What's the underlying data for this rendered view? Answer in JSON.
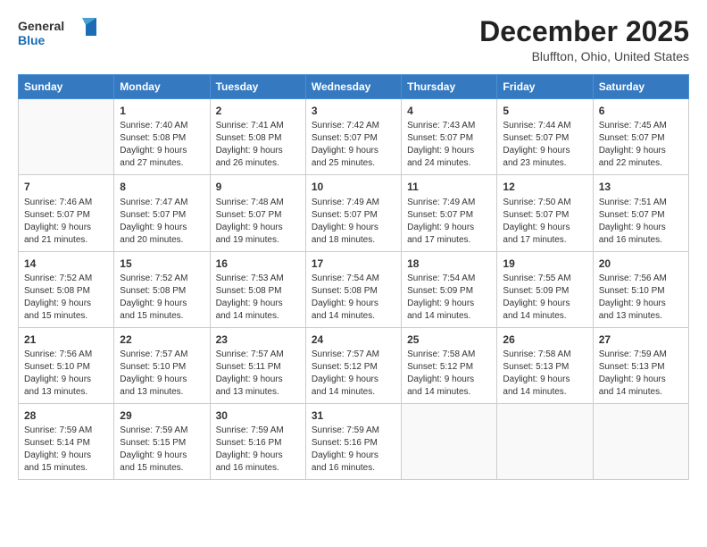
{
  "header": {
    "logo_line1": "General",
    "logo_line2": "Blue",
    "month": "December 2025",
    "location": "Bluffton, Ohio, United States"
  },
  "weekdays": [
    "Sunday",
    "Monday",
    "Tuesday",
    "Wednesday",
    "Thursday",
    "Friday",
    "Saturday"
  ],
  "weeks": [
    [
      {
        "day": "",
        "info": ""
      },
      {
        "day": "1",
        "info": "Sunrise: 7:40 AM\nSunset: 5:08 PM\nDaylight: 9 hours\nand 27 minutes."
      },
      {
        "day": "2",
        "info": "Sunrise: 7:41 AM\nSunset: 5:08 PM\nDaylight: 9 hours\nand 26 minutes."
      },
      {
        "day": "3",
        "info": "Sunrise: 7:42 AM\nSunset: 5:07 PM\nDaylight: 9 hours\nand 25 minutes."
      },
      {
        "day": "4",
        "info": "Sunrise: 7:43 AM\nSunset: 5:07 PM\nDaylight: 9 hours\nand 24 minutes."
      },
      {
        "day": "5",
        "info": "Sunrise: 7:44 AM\nSunset: 5:07 PM\nDaylight: 9 hours\nand 23 minutes."
      },
      {
        "day": "6",
        "info": "Sunrise: 7:45 AM\nSunset: 5:07 PM\nDaylight: 9 hours\nand 22 minutes."
      }
    ],
    [
      {
        "day": "7",
        "info": "Sunrise: 7:46 AM\nSunset: 5:07 PM\nDaylight: 9 hours\nand 21 minutes."
      },
      {
        "day": "8",
        "info": "Sunrise: 7:47 AM\nSunset: 5:07 PM\nDaylight: 9 hours\nand 20 minutes."
      },
      {
        "day": "9",
        "info": "Sunrise: 7:48 AM\nSunset: 5:07 PM\nDaylight: 9 hours\nand 19 minutes."
      },
      {
        "day": "10",
        "info": "Sunrise: 7:49 AM\nSunset: 5:07 PM\nDaylight: 9 hours\nand 18 minutes."
      },
      {
        "day": "11",
        "info": "Sunrise: 7:49 AM\nSunset: 5:07 PM\nDaylight: 9 hours\nand 17 minutes."
      },
      {
        "day": "12",
        "info": "Sunrise: 7:50 AM\nSunset: 5:07 PM\nDaylight: 9 hours\nand 17 minutes."
      },
      {
        "day": "13",
        "info": "Sunrise: 7:51 AM\nSunset: 5:07 PM\nDaylight: 9 hours\nand 16 minutes."
      }
    ],
    [
      {
        "day": "14",
        "info": "Sunrise: 7:52 AM\nSunset: 5:08 PM\nDaylight: 9 hours\nand 15 minutes."
      },
      {
        "day": "15",
        "info": "Sunrise: 7:52 AM\nSunset: 5:08 PM\nDaylight: 9 hours\nand 15 minutes."
      },
      {
        "day": "16",
        "info": "Sunrise: 7:53 AM\nSunset: 5:08 PM\nDaylight: 9 hours\nand 14 minutes."
      },
      {
        "day": "17",
        "info": "Sunrise: 7:54 AM\nSunset: 5:08 PM\nDaylight: 9 hours\nand 14 minutes."
      },
      {
        "day": "18",
        "info": "Sunrise: 7:54 AM\nSunset: 5:09 PM\nDaylight: 9 hours\nand 14 minutes."
      },
      {
        "day": "19",
        "info": "Sunrise: 7:55 AM\nSunset: 5:09 PM\nDaylight: 9 hours\nand 14 minutes."
      },
      {
        "day": "20",
        "info": "Sunrise: 7:56 AM\nSunset: 5:10 PM\nDaylight: 9 hours\nand 13 minutes."
      }
    ],
    [
      {
        "day": "21",
        "info": "Sunrise: 7:56 AM\nSunset: 5:10 PM\nDaylight: 9 hours\nand 13 minutes."
      },
      {
        "day": "22",
        "info": "Sunrise: 7:57 AM\nSunset: 5:10 PM\nDaylight: 9 hours\nand 13 minutes."
      },
      {
        "day": "23",
        "info": "Sunrise: 7:57 AM\nSunset: 5:11 PM\nDaylight: 9 hours\nand 13 minutes."
      },
      {
        "day": "24",
        "info": "Sunrise: 7:57 AM\nSunset: 5:12 PM\nDaylight: 9 hours\nand 14 minutes."
      },
      {
        "day": "25",
        "info": "Sunrise: 7:58 AM\nSunset: 5:12 PM\nDaylight: 9 hours\nand 14 minutes."
      },
      {
        "day": "26",
        "info": "Sunrise: 7:58 AM\nSunset: 5:13 PM\nDaylight: 9 hours\nand 14 minutes."
      },
      {
        "day": "27",
        "info": "Sunrise: 7:59 AM\nSunset: 5:13 PM\nDaylight: 9 hours\nand 14 minutes."
      }
    ],
    [
      {
        "day": "28",
        "info": "Sunrise: 7:59 AM\nSunset: 5:14 PM\nDaylight: 9 hours\nand 15 minutes."
      },
      {
        "day": "29",
        "info": "Sunrise: 7:59 AM\nSunset: 5:15 PM\nDaylight: 9 hours\nand 15 minutes."
      },
      {
        "day": "30",
        "info": "Sunrise: 7:59 AM\nSunset: 5:16 PM\nDaylight: 9 hours\nand 16 minutes."
      },
      {
        "day": "31",
        "info": "Sunrise: 7:59 AM\nSunset: 5:16 PM\nDaylight: 9 hours\nand 16 minutes."
      },
      {
        "day": "",
        "info": ""
      },
      {
        "day": "",
        "info": ""
      },
      {
        "day": "",
        "info": ""
      }
    ]
  ]
}
